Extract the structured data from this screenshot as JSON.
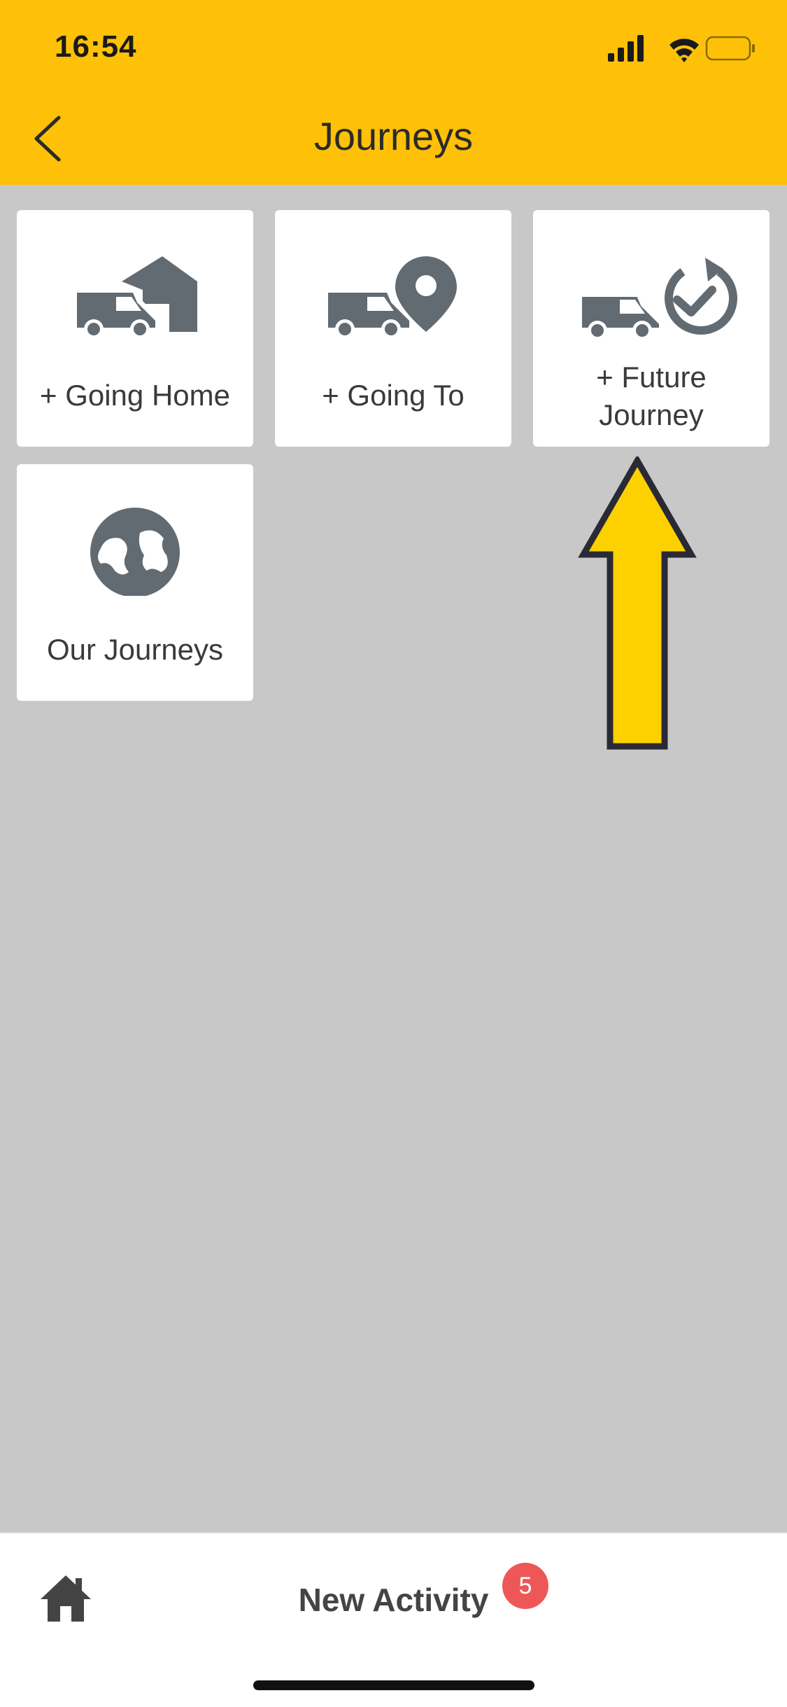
{
  "status_bar": {
    "time": "16:54",
    "icons": [
      "cellular-signal-icon",
      "wifi-icon",
      "battery-icon"
    ]
  },
  "header": {
    "title": "Journeys",
    "back_icon": "chevron-left-icon",
    "background_color": "#fec107"
  },
  "tiles": [
    {
      "label": "+ Going Home",
      "icon": "van-home-icon"
    },
    {
      "label": "+ Going To",
      "icon": "van-location-pin-icon"
    },
    {
      "label": "+ Future Journey",
      "icon": "van-scheduled-check-icon"
    },
    {
      "label": "Our Journeys",
      "icon": "globe-icon"
    }
  ],
  "annotation": {
    "icon": "arrow-up-icon",
    "color": "#fdd000"
  },
  "bottom_bar": {
    "home_icon": "home-icon",
    "new_activity_label": "New Activity",
    "badge_count": "5",
    "badge_color": "#ee5757"
  },
  "colors": {
    "icon_gray": "#626a72",
    "page_background": "#c8c8c8"
  }
}
